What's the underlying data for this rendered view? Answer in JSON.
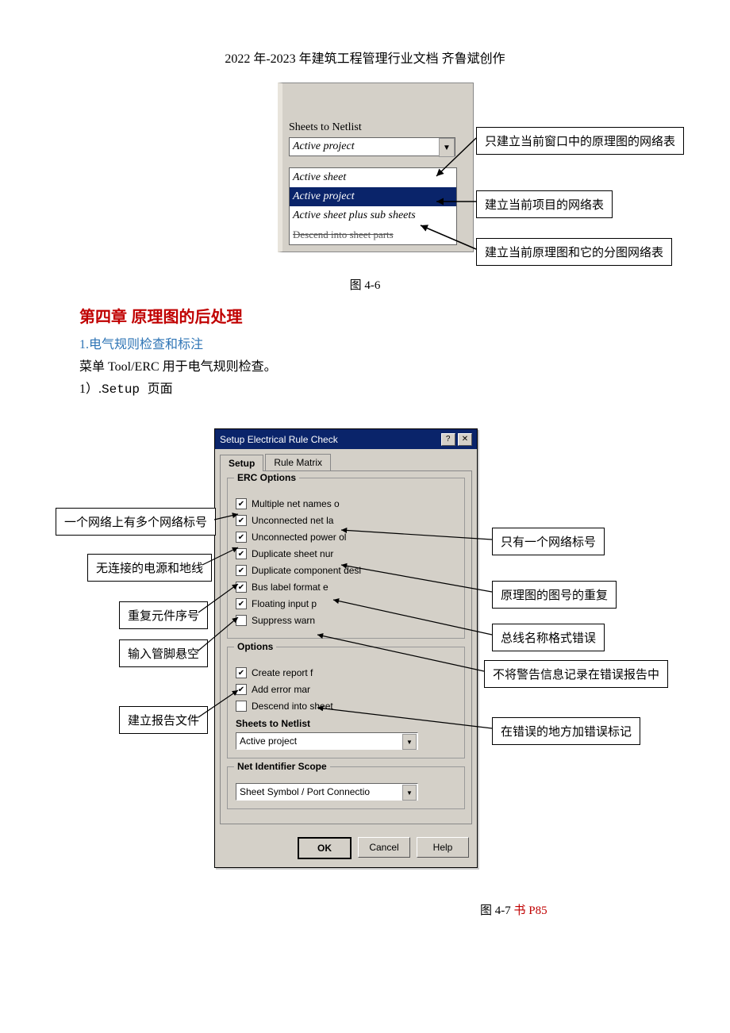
{
  "header": "2022 年-2023 年建筑工程管理行业文档  齐鲁斌创作",
  "fig46": {
    "sheets_label": "Sheets to Netlist",
    "selected": "Active project",
    "options": [
      "Active sheet",
      "Active project",
      "Active sheet plus sub sheets"
    ],
    "crossed": "Descend into sheet parts",
    "caption": "图 4-6",
    "callouts": {
      "c1": "只建立当前窗口中的原理图的网络表",
      "c2": "建立当前项目的网络表",
      "c3": "建立当前原理图和它的分图网络表"
    }
  },
  "chapter_title": "第四章  原理图的后处理",
  "sub1": "1.电气规则检查和标注",
  "body1": "菜单 Tool/ERC 用于电气规则检查。",
  "body2_a": "1）.",
  "body2_b": "Setup ",
  "body2_c": "页面",
  "fig47": {
    "dlg_title": "Setup Electrical Rule Check",
    "tabs": {
      "setup": "Setup",
      "matrix": "Rule Matrix"
    },
    "group_erc": "ERC Options",
    "chk": {
      "c1": "Multiple net names o",
      "c2": "Unconnected net la",
      "c3": "Unconnected power ol",
      "c4": "Duplicate sheet nur",
      "c5": "Duplicate component desi",
      "c6": "Bus label format e",
      "c7": "Floating input p",
      "c8": "Suppress warn"
    },
    "group_opt": "Options",
    "opt": {
      "o1": "Create report f",
      "o2": "Add error mar",
      "o3": "Descend into sheet"
    },
    "stn_label": "Sheets to Netlist",
    "stn_sel": "Active project",
    "nis_label": "Net Identifier Scope",
    "nis_sel": "Sheet Symbol / Port Connectio",
    "btns": {
      "ok": "OK",
      "cancel": "Cancel",
      "help": "Help"
    },
    "callouts": {
      "l1": "一个网络上有多个网络标号",
      "l2": "无连接的电源和地线",
      "l3": "重复元件序号",
      "l4": "输入管脚悬空",
      "l5": "建立报告文件",
      "r1": "只有一个网络标号",
      "r2": "原理图的图号的重复",
      "r3": "总线名称格式错误",
      "r4": "不将警告信息记录在错误报告中",
      "r5": "在错误的地方加错误标记"
    },
    "caption_a": "图 4-7",
    "caption_b": "书 P85"
  }
}
